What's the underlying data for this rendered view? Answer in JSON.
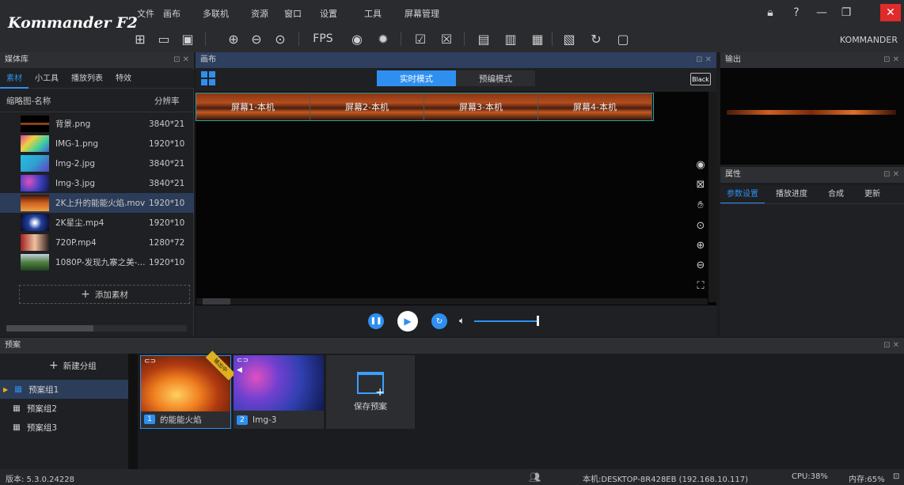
{
  "app": {
    "logo": "Kommander F2",
    "user": "KOMMANDER"
  },
  "menu": [
    "文件",
    "画布",
    "多联机",
    "资源",
    "窗口",
    "设置",
    "工具",
    "屏幕管理"
  ],
  "toolbar": {
    "fps_label": "FPS"
  },
  "media_panel": {
    "title": "媒体库",
    "tabs": [
      "素材",
      "小工具",
      "播放列表",
      "特效"
    ],
    "active_tab": 0,
    "col_name": "缩略图-名称",
    "col_res": "分辨率",
    "items": [
      {
        "name": "背景.png",
        "res": "3840*21",
        "thumb": "bg-ribbon"
      },
      {
        "name": "IMG-1.png",
        "res": "1920*10",
        "thumb": "rainbow"
      },
      {
        "name": "Img-2.jpg",
        "res": "3840*21",
        "thumb": "cyan"
      },
      {
        "name": "Img-3.jpg",
        "res": "3840*21",
        "thumb": "bluepurple"
      },
      {
        "name": "2K上升的能能火焰.mov",
        "res": "1920*10",
        "thumb": "fire",
        "selected": true
      },
      {
        "name": "2K星尘.mp4",
        "res": "1920*10",
        "thumb": "stardust"
      },
      {
        "name": "720P.mp4",
        "res": "1280*72",
        "thumb": "portrait"
      },
      {
        "name": "1080P-发现九寨之美-...",
        "res": "1920*10",
        "thumb": "landscape"
      }
    ],
    "add_label": "添加素材"
  },
  "canvas_panel": {
    "title": "画布",
    "mode_realtime": "实时模式",
    "mode_preedit": "预编模式",
    "black_label": "Black",
    "screens": [
      "屏幕1-本机",
      "屏幕2-本机",
      "屏幕3-本机",
      "屏幕4-本机"
    ]
  },
  "output_panel": {
    "title": "输出"
  },
  "properties_panel": {
    "title": "属性",
    "tabs": [
      "参数设置",
      "播放进度",
      "合成",
      "更新"
    ],
    "active_tab": 0
  },
  "preset_panel": {
    "title": "预案",
    "new_group": "新建分组",
    "groups": [
      {
        "name": "预案组1",
        "active": true
      },
      {
        "name": "预案组2"
      },
      {
        "name": "预案组3"
      }
    ],
    "cards": [
      {
        "index": "1",
        "name": "的能能火焰",
        "on_air": "输出中"
      },
      {
        "index": "2",
        "name": "Img-3"
      }
    ],
    "save_label": "保存预案"
  },
  "status": {
    "version": "版本: 5.3.0.24228",
    "host": "本机:DESKTOP-8R428EB (192.168.10.117)",
    "cpu": "CPU:38%",
    "mem": "内存:65%"
  },
  "colors": {
    "accent": "#2f8ff0",
    "bg": "#1b1c1f"
  }
}
